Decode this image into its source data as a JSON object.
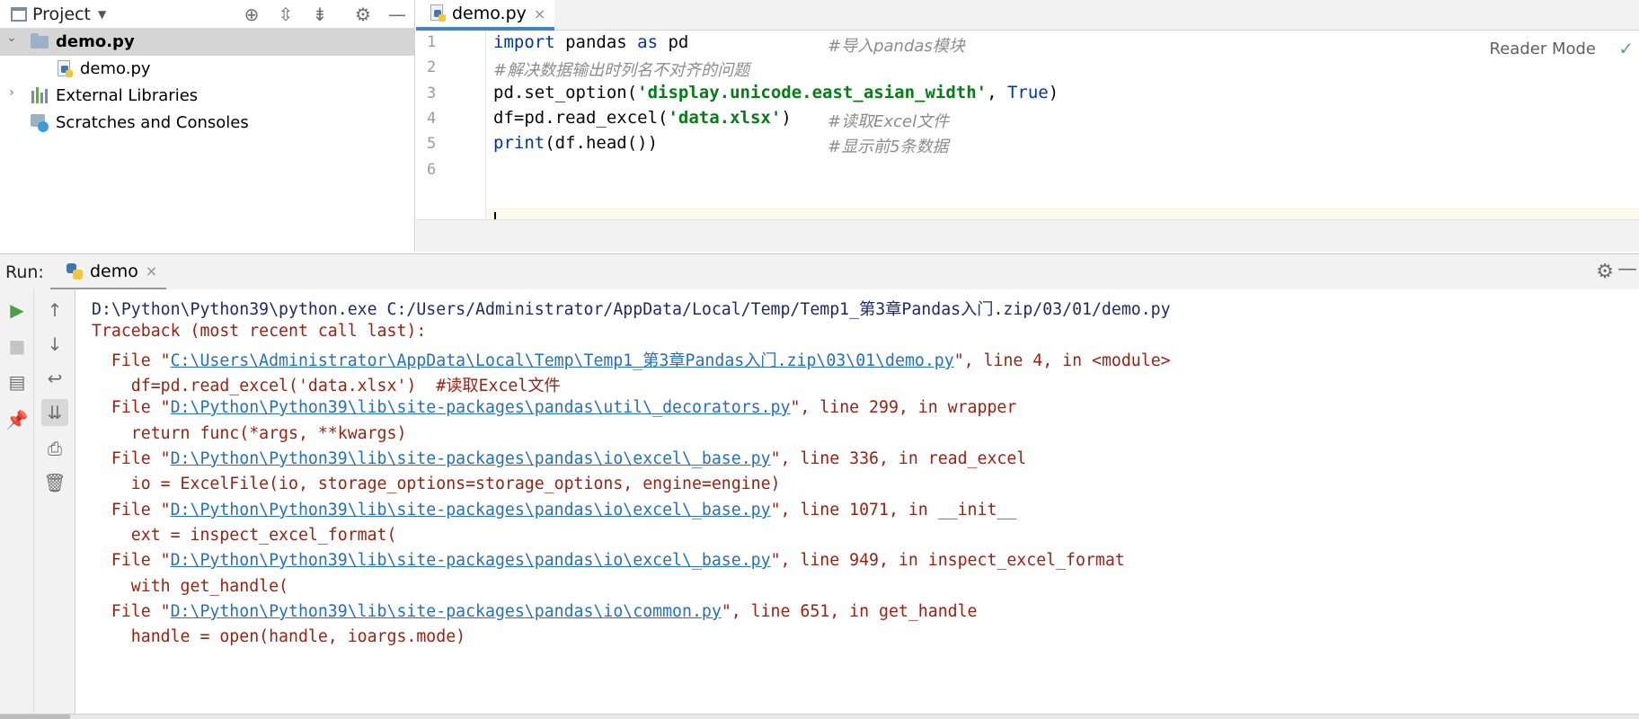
{
  "project_panel": {
    "title": "Project",
    "tree": [
      {
        "label": "demo.py",
        "bold": true,
        "selected": true,
        "expanded": true
      },
      {
        "label": "demo.py"
      },
      {
        "label": "External Libraries"
      },
      {
        "label": "Scratches and Consoles"
      }
    ]
  },
  "editor": {
    "tab_label": "demo.py",
    "reader_mode": "Reader Mode",
    "line_numbers": [
      "1",
      "2",
      "3",
      "4",
      "5",
      "6"
    ],
    "lines": {
      "l1_kw1": "import",
      "l1_mid": " pandas ",
      "l1_kw2": "as",
      "l1_end": " pd",
      "l1_comment": "#导入pandas模块",
      "l2_comment": "#解决数据输出时列名不对齐的问题",
      "l3_pre": "pd.set_option(",
      "l3_str": "'display.unicode.east_asian_width'",
      "l3_mid": ", ",
      "l3_kw": "True",
      "l3_post": ")",
      "l4_pre": "df=pd.read_excel(",
      "l4_str": "'data.xlsx'",
      "l4_post": ")",
      "l4_comment": "#读取Excel文件",
      "l5_kw": "print",
      "l5_post": "(df.head())",
      "l5_comment": "#显示前5条数据"
    }
  },
  "run_panel": {
    "label": "Run:",
    "tab_label": "demo"
  },
  "console": {
    "cmd": "D:\\Python\\Python39\\python.exe C:/Users/Administrator/AppData/Local/Temp/Temp1_第3章Pandas入门.zip/03/01/demo.py",
    "traceback": "Traceback (most recent call last):",
    "f1_pre": "  File \"",
    "f1_link": "C:\\Users\\Administrator\\AppData\\Local\\Temp\\Temp1_第3章Pandas入门.zip\\03\\01\\demo.py",
    "f1_post": "\", line 4, in <module>",
    "c1": "    df=pd.read_excel('data.xlsx')  #读取Excel文件",
    "f2_pre": "  File \"",
    "f2_link": "D:\\Python\\Python39\\lib\\site-packages\\pandas\\util\\_decorators.py",
    "f2_post": "\", line 299, in wrapper",
    "c2": "    return func(*args, **kwargs)",
    "f3_pre": "  File \"",
    "f3_link": "D:\\Python\\Python39\\lib\\site-packages\\pandas\\io\\excel\\_base.py",
    "f3_post": "\", line 336, in read_excel",
    "c3": "    io = ExcelFile(io, storage_options=storage_options, engine=engine)",
    "f4_pre": "  File \"",
    "f4_link": "D:\\Python\\Python39\\lib\\site-packages\\pandas\\io\\excel\\_base.py",
    "f4_post": "\", line 1071, in __init__",
    "c4": "    ext = inspect_excel_format(",
    "f5_pre": "  File \"",
    "f5_link": "D:\\Python\\Python39\\lib\\site-packages\\pandas\\io\\excel\\_base.py",
    "f5_post": "\", line 949, in inspect_excel_format",
    "c5": "    with get_handle(",
    "f6_pre": "  File \"",
    "f6_link": "D:\\Python\\Python39\\lib\\site-packages\\pandas\\io\\common.py",
    "f6_post": "\", line 651, in get_handle",
    "c6": "    handle = open(handle, ioargs.mode)"
  },
  "icons": {
    "close_glyph": "×",
    "expand_arrow": "⌄",
    "collapse_arrow": "›",
    "check_glyph": "✓"
  },
  "colors": {
    "keyword": "#0033b3",
    "string": "#067d17",
    "comment": "#8c8c8c",
    "error_text": "#9c1f0f",
    "link": "#2470c2",
    "accent_tab": "#4083c9"
  }
}
